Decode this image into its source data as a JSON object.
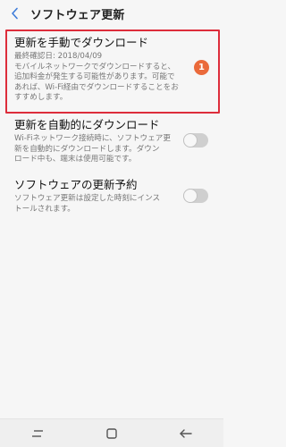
{
  "header": {
    "title": "ソフトウェア更新",
    "back_icon": "back-arrow-icon"
  },
  "items": [
    {
      "title": "更新を手動でダウンロード",
      "lines": [
        "最終確認日: 2018/04/09",
        "モバイルネットワークでダウンロードすると、",
        "追加料金が発生する可能性があります。可能で",
        "あれば、Wi-Fi経由でダウンロードすることをお",
        "すすめします。"
      ],
      "badge": "1",
      "highlighted": true
    },
    {
      "title": "更新を自動的にダウンロード",
      "lines": [
        "Wi-Fiネットワーク接続時に、ソフトウェア更",
        "新を自動的にダウンロードします。ダウン",
        "ロード中も、端末は使用可能です。"
      ],
      "toggle_on": false
    },
    {
      "title": "ソフトウェアの更新予約",
      "lines": [
        "ソフトウェア更新は設定した時刻にインス",
        "トールされます。"
      ],
      "toggle_on": false
    }
  ],
  "navbar": {
    "recent_icon": "recent-apps-icon",
    "home_icon": "home-icon",
    "back_icon": "back-icon"
  },
  "colors": {
    "highlight": "#dd2d3b",
    "badge": "#ea6a3b",
    "accent": "#3d7bd9"
  }
}
